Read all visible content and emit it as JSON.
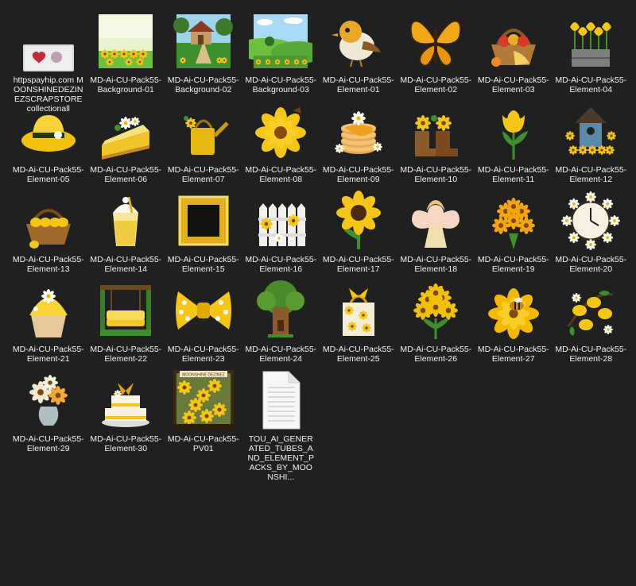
{
  "window": {
    "background": "#202020",
    "text_color": "#f2f2f2"
  },
  "files": [
    {
      "name": "httpspayhip.com MOONSHINEDEZINEZSCRAPSTOREcollectionall",
      "icon": "website-shortcut-icon",
      "kind": "shortcut"
    },
    {
      "name": "MD-Ai-CU-Pack55-Background-01",
      "icon": "meadow-flowers-background-icon",
      "kind": "bg1"
    },
    {
      "name": "MD-Ai-CU-Pack55-Background-02",
      "icon": "cottage-path-background-icon",
      "kind": "bg2"
    },
    {
      "name": "MD-Ai-CU-Pack55-Background-03",
      "icon": "green-hills-background-icon",
      "kind": "bg3"
    },
    {
      "name": "MD-Ai-CU-Pack55-Element-01",
      "icon": "bird-icon",
      "kind": "bird"
    },
    {
      "name": "MD-Ai-CU-Pack55-Element-02",
      "icon": "butterfly-icon",
      "kind": "butterfly"
    },
    {
      "name": "MD-Ai-CU-Pack55-Element-03",
      "icon": "fruit-basket-icon",
      "kind": "basket"
    },
    {
      "name": "MD-Ai-CU-Pack55-Element-04",
      "icon": "tulip-crate-icon",
      "kind": "tulipcrate"
    },
    {
      "name": "MD-Ai-CU-Pack55-Element-05",
      "icon": "sun-hat-icon",
      "kind": "hat"
    },
    {
      "name": "MD-Ai-CU-Pack55-Element-06",
      "icon": "lemon-pie-slice-icon",
      "kind": "pie"
    },
    {
      "name": "MD-Ai-CU-Pack55-Element-07",
      "icon": "watering-can-icon",
      "kind": "can"
    },
    {
      "name": "MD-Ai-CU-Pack55-Element-08",
      "icon": "yellow-flower-icon",
      "kind": "flower"
    },
    {
      "name": "MD-Ai-CU-Pack55-Element-09",
      "icon": "pancake-stack-icon",
      "kind": "pancakes"
    },
    {
      "name": "MD-Ai-CU-Pack55-Element-10",
      "icon": "flower-boots-icon",
      "kind": "boots"
    },
    {
      "name": "MD-Ai-CU-Pack55-Element-11",
      "icon": "tulip-icon",
      "kind": "tulip"
    },
    {
      "name": "MD-Ai-CU-Pack55-Element-12",
      "icon": "birdhouse-icon",
      "kind": "birdhouse"
    },
    {
      "name": "MD-Ai-CU-Pack55-Element-13",
      "icon": "lemon-basket-icon",
      "kind": "lemonbasket"
    },
    {
      "name": "MD-Ai-CU-Pack55-Element-14",
      "icon": "milkshake-icon",
      "kind": "shake"
    },
    {
      "name": "MD-Ai-CU-Pack55-Element-15",
      "icon": "gold-frame-icon",
      "kind": "frame"
    },
    {
      "name": "MD-Ai-CU-Pack55-Element-16",
      "icon": "picket-fence-icon",
      "kind": "fence"
    },
    {
      "name": "MD-Ai-CU-Pack55-Element-17",
      "icon": "sunflower-icon",
      "kind": "sunflower"
    },
    {
      "name": "MD-Ai-CU-Pack55-Element-18",
      "icon": "fairy-icon",
      "kind": "fairy"
    },
    {
      "name": "MD-Ai-CU-Pack55-Element-19",
      "icon": "marigold-bouquet-icon",
      "kind": "bouquet"
    },
    {
      "name": "MD-Ai-CU-Pack55-Element-20",
      "icon": "floral-clock-icon",
      "kind": "clock"
    },
    {
      "name": "MD-Ai-CU-Pack55-Element-21",
      "icon": "cupcake-icon",
      "kind": "cupcake"
    },
    {
      "name": "MD-Ai-CU-Pack55-Element-22",
      "icon": "garden-swing-icon",
      "kind": "swing"
    },
    {
      "name": "MD-Ai-CU-Pack55-Element-23",
      "icon": "polka-bow-icon",
      "kind": "bow"
    },
    {
      "name": "MD-Ai-CU-Pack55-Element-24",
      "icon": "tree-house-icon",
      "kind": "treehouse"
    },
    {
      "name": "MD-Ai-CU-Pack55-Element-25",
      "icon": "gift-bag-icon",
      "kind": "giftbag"
    },
    {
      "name": "MD-Ai-CU-Pack55-Element-26",
      "icon": "hydrangea-icon",
      "kind": "hydrangea"
    },
    {
      "name": "MD-Ai-CU-Pack55-Element-27",
      "icon": "flower-bee-icon",
      "kind": "bee"
    },
    {
      "name": "MD-Ai-CU-Pack55-Element-28",
      "icon": "lemon-branch-icon",
      "kind": "lemons"
    },
    {
      "name": "MD-Ai-CU-Pack55-Element-29",
      "icon": "flower-vase-icon",
      "kind": "vase"
    },
    {
      "name": "MD-Ai-CU-Pack55-Element-30",
      "icon": "layer-cake-icon",
      "kind": "cake"
    },
    {
      "name": "MD-Ai-CU-Pack55-PV01",
      "icon": "preview-collage-icon",
      "kind": "preview",
      "preview_banner": "MOONSHINE DEZINEZ"
    },
    {
      "name": "TOU_AI_GENERATED_TUBES_AND_ELEMENT_PACKS_BY_MOONSHI...",
      "icon": "text-document-icon",
      "kind": "doc"
    }
  ]
}
